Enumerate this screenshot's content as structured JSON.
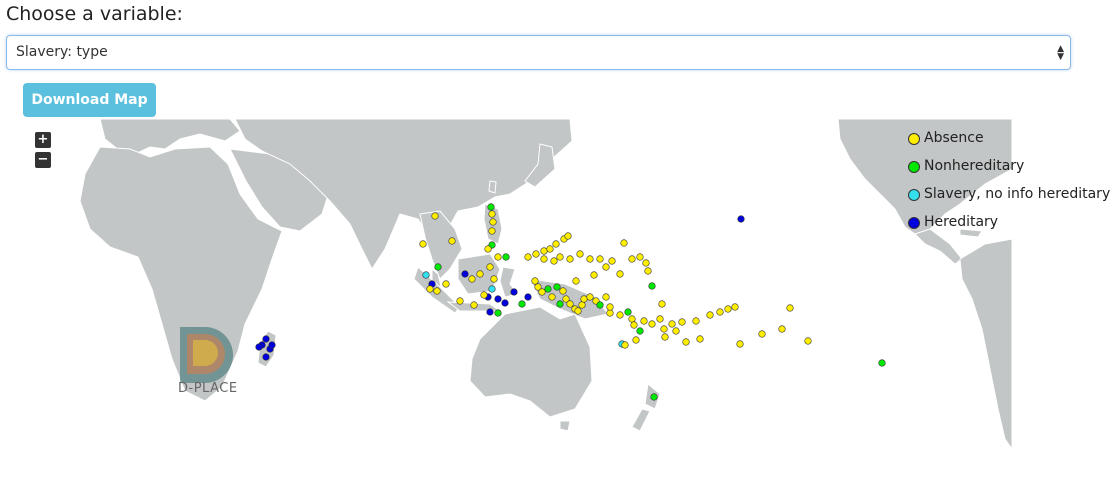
{
  "header": {
    "title": "Choose a variable:"
  },
  "variable_select": {
    "selected": "Slavery: type",
    "arrows": "▲▼"
  },
  "download_button": {
    "label": "Download Map"
  },
  "map": {
    "zoom_in_label": "+",
    "zoom_out_label": "−",
    "logo_text": "D-PLACE",
    "colors": {
      "land": "#c3c6c6",
      "border": "#ffffff",
      "sea": "#ffffff"
    },
    "legend": [
      {
        "label": "Absence",
        "color": "#ffee00"
      },
      {
        "label": "Nonhereditary",
        "color": "#00e800"
      },
      {
        "label": "Slavery, no info hereditary",
        "color": "#33e0ee"
      },
      {
        "label": "Hereditary",
        "color": "#0000dd"
      }
    ]
  }
}
